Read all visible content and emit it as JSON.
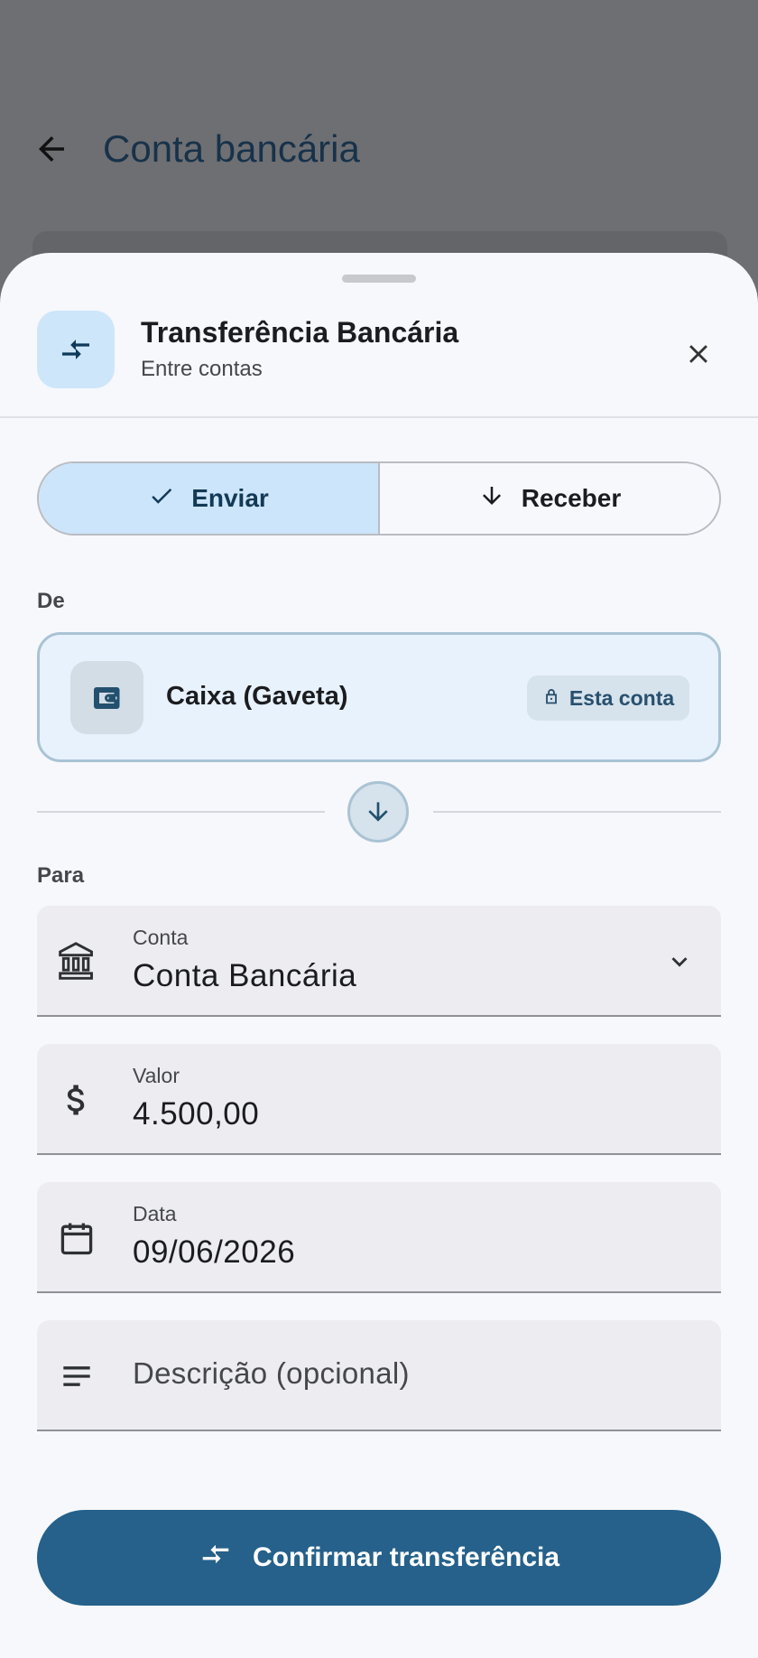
{
  "background": {
    "title": "Conta bancária"
  },
  "sheet": {
    "title": "Transferência Bancária",
    "subtitle": "Entre contas",
    "segments": {
      "send": "Enviar",
      "receive": "Receber"
    },
    "from": {
      "label": "De",
      "account_name": "Caixa (Gaveta)",
      "chip": "Esta conta"
    },
    "to": {
      "label": "Para"
    },
    "fields": {
      "account": {
        "label": "Conta",
        "value": "Conta Bancária"
      },
      "amount": {
        "label": "Valor",
        "value": "4.500,00"
      },
      "date": {
        "label": "Data",
        "value": "09/06/2026"
      },
      "description": {
        "placeholder": "Descrição (opcional)"
      }
    },
    "confirm_label": "Confirmar transferência"
  },
  "colors": {
    "accent": "#25618a",
    "segment_active": "#cce5fa",
    "from_card": "#e8f2fc"
  }
}
